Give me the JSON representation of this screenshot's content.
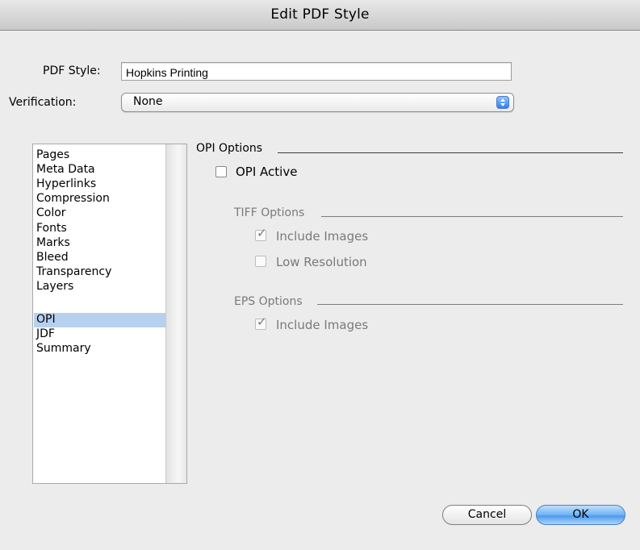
{
  "window": {
    "title": "Edit PDF Style"
  },
  "form": {
    "pdf_style_label": "PDF Style:",
    "pdf_style_value": "Hopkins Printing",
    "verification_label": "Verification:",
    "verification_value": "None"
  },
  "sidebar": {
    "items": [
      {
        "label": "Pages",
        "selected": false
      },
      {
        "label": "Meta Data",
        "selected": false
      },
      {
        "label": "Hyperlinks",
        "selected": false
      },
      {
        "label": "Compression",
        "selected": false
      },
      {
        "label": "Color",
        "selected": false
      },
      {
        "label": "Fonts",
        "selected": false
      },
      {
        "label": "Marks",
        "selected": false
      },
      {
        "label": "Bleed",
        "selected": false
      },
      {
        "label": "Transparency",
        "selected": false
      },
      {
        "label": "Layers",
        "selected": false
      },
      {
        "label": "OPI",
        "selected": true
      },
      {
        "label": "JDF",
        "selected": false
      },
      {
        "label": "Summary",
        "selected": false
      }
    ]
  },
  "opi": {
    "section_title": "OPI Options",
    "opi_active_label": "OPI Active",
    "opi_active_checked": false,
    "tiff": {
      "section_title": "TIFF Options",
      "include_images_label": "Include Images",
      "include_images_checked": true,
      "low_resolution_label": "Low Resolution",
      "low_resolution_checked": false
    },
    "eps": {
      "section_title": "EPS Options",
      "include_images_label": "Include Images",
      "include_images_checked": true
    }
  },
  "buttons": {
    "cancel": "Cancel",
    "ok": "OK"
  },
  "colors": {
    "selection": "#b7d0ee",
    "default_button": "#6fb2f5",
    "window_bg": "#ececec"
  }
}
